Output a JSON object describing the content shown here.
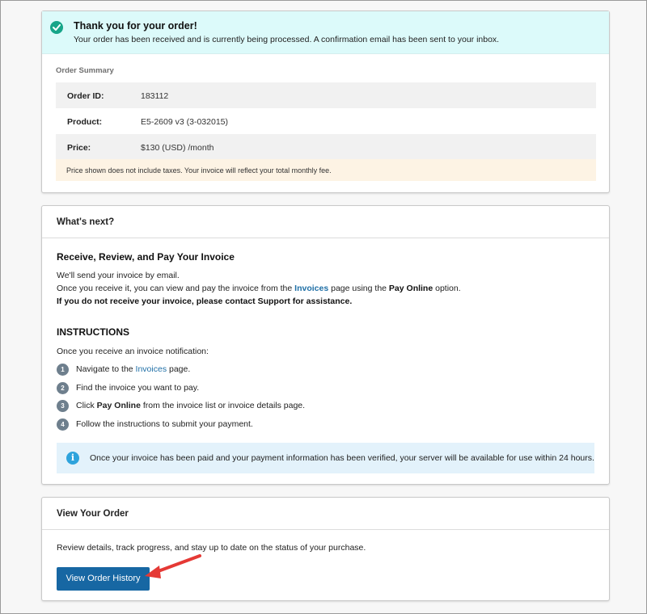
{
  "confirmation": {
    "title": "Thank you for your order!",
    "message": "Your order has been received and is currently being processed. A confirmation email has been sent to your inbox.",
    "summary_label": "Order Summary",
    "rows": [
      {
        "label": "Order ID:",
        "value": "183112"
      },
      {
        "label": "Product:",
        "value": "E5-2609 v3 (3-032015)"
      },
      {
        "label": "Price:",
        "value": "$130 (USD) /month"
      }
    ],
    "tax_note": "Price shown does not include taxes. Your invoice will reflect your total monthly fee."
  },
  "whats_next": {
    "title": "What's next?",
    "section1_title": "Receive, Review, and Pay Your Invoice",
    "line1": "We'll send your invoice by email.",
    "line2_pre": "Once you receive it, you can view and pay the invoice from the ",
    "line2_link": "Invoices",
    "line2_mid": " page using the ",
    "line2_bold": "Pay Online",
    "line2_post": " option.",
    "line3": "If you do not receive your invoice, please contact Support for assistance.",
    "instructions_title": "INSTRUCTIONS",
    "instructions_intro": "Once you receive an invoice notification:",
    "steps": [
      {
        "num": "1",
        "pre": "Navigate to the ",
        "link": "Invoices",
        "post": " page."
      },
      {
        "num": "2",
        "text": "Find the invoice you want to pay."
      },
      {
        "num": "3",
        "pre": "Click ",
        "bold": "Pay Online",
        "post": " from the invoice list or invoice details page."
      },
      {
        "num": "4",
        "text": "Follow the instructions to submit your payment."
      }
    ],
    "info": "Once your invoice has been paid and your payment information has been verified, your server will be available for use within 24 hours."
  },
  "view_order": {
    "title": "View Your Order",
    "description": "Review details, track progress, and stay up to date on the status of your purchase.",
    "button_label": "View Order History"
  },
  "colors": {
    "banner_bg": "#dcfafa",
    "success": "#17a589",
    "link": "#1f6fa6",
    "primary_button": "#1767a3",
    "info_bg": "#e3f2fb",
    "annotation_arrow": "#e53935"
  }
}
